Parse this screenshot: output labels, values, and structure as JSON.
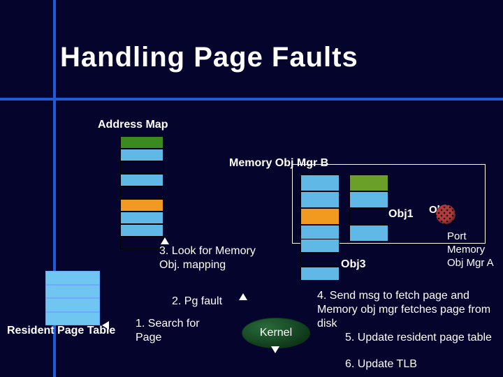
{
  "title": "Handling Page Faults",
  "labels": {
    "address_map": "Address Map",
    "mem_mgr_b": "Memory Obj Mgr B",
    "obj1": "Obj1",
    "obj2": "Obj2",
    "obj3": "Obj3",
    "port": "Port",
    "mem_mgr_a_l1": "Memory",
    "mem_mgr_a_l2": "Obj Mgr A",
    "rpt": "Resident Page Table",
    "kernel": "Kernel"
  },
  "steps": {
    "s1": "1.  Search for Page",
    "s2": "2. Pg fault",
    "s3": "3. Look for Memory Obj. mapping",
    "s4": "4. Send msg to fetch page and Memory obj mgr fetches page from disk",
    "s5": "5. Update resident page table",
    "s6": "6. Update TLB"
  },
  "colors": {
    "green": "#3a8a1f",
    "blue": "#5fb8e6",
    "orange": "#f29a1f",
    "navy": "#04042c",
    "darkgreen": "#6aa02a"
  },
  "address_map_cells": [
    "green",
    "blue",
    "navy",
    "blue",
    "navy",
    "orange",
    "blue",
    "blue",
    "navy"
  ],
  "obj1_cells": [
    "blue",
    "blue",
    "orange",
    "blue"
  ],
  "obj2_cells": [
    "darkgreen",
    "blue",
    "navy",
    "blue"
  ],
  "obj3_cells": [
    "blue",
    "navy",
    "blue"
  ]
}
